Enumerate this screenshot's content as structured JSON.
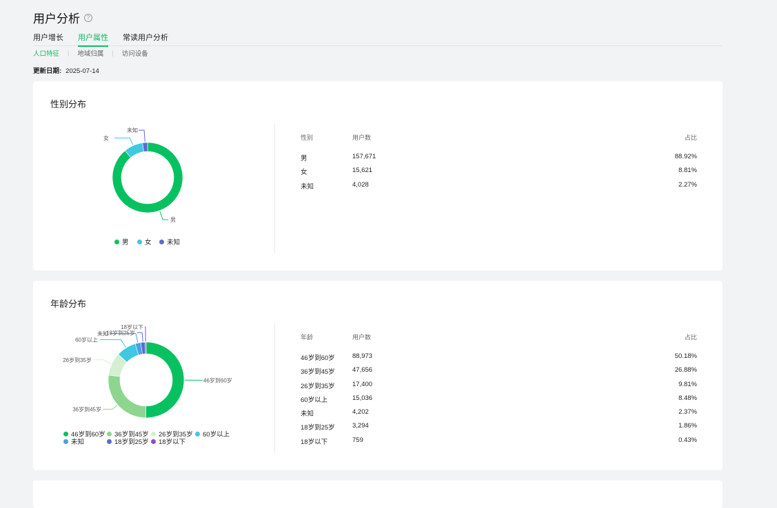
{
  "header": {
    "title": "用户分析",
    "help_icon": "question-circle-icon"
  },
  "tabs": [
    {
      "label": "用户增长",
      "active": false
    },
    {
      "label": "用户属性",
      "active": true
    },
    {
      "label": "常读用户分析",
      "active": false
    }
  ],
  "subtabs": [
    {
      "label": "人口特征",
      "active": true
    },
    {
      "label": "地域归属",
      "active": false
    },
    {
      "label": "访问设备",
      "active": false
    }
  ],
  "update": {
    "label": "更新日期:",
    "date": "2025-07-14"
  },
  "colors": {
    "accent": "#07c160"
  },
  "gender": {
    "title": "性别分布",
    "columns": [
      "性别",
      "用户数",
      "占比"
    ],
    "rows": [
      {
        "name": "男",
        "users": "157,671",
        "pct": "88.92%"
      },
      {
        "name": "女",
        "users": "15,621",
        "pct": "8.81%"
      },
      {
        "name": "未知",
        "users": "4,028",
        "pct": "2.27%"
      }
    ],
    "legend": [
      "男",
      "女",
      "未知"
    ]
  },
  "age": {
    "title": "年龄分布",
    "columns": [
      "年龄",
      "用户数",
      "占比"
    ],
    "rows": [
      {
        "name": "46岁到60岁",
        "users": "88,973",
        "pct": "50.18%"
      },
      {
        "name": "36岁到45岁",
        "users": "47,656",
        "pct": "26.88%"
      },
      {
        "name": "26岁到35岁",
        "users": "17,400",
        "pct": "9.81%"
      },
      {
        "name": "60岁以上",
        "users": "15,036",
        "pct": "8.48%"
      },
      {
        "name": "未知",
        "users": "4,202",
        "pct": "2.37%"
      },
      {
        "name": "18岁到25岁",
        "users": "3,294",
        "pct": "1.86%"
      },
      {
        "name": "18岁以下",
        "users": "759",
        "pct": "0.43%"
      }
    ],
    "legend": [
      "46岁到60岁",
      "36岁到45岁",
      "26岁到35岁",
      "60岁以上",
      "未知",
      "18岁到25岁",
      "18岁以下"
    ]
  },
  "chart_data": [
    {
      "type": "pie",
      "title": "性别分布",
      "categories": [
        "男",
        "女",
        "未知"
      ],
      "values": [
        88.92,
        8.81,
        2.27
      ],
      "colors": [
        "#07c160",
        "#3fc8e0",
        "#5b6bd0"
      ],
      "legend_position": "bottom"
    },
    {
      "type": "pie",
      "title": "年龄分布",
      "categories": [
        "46岁到60岁",
        "36岁到45岁",
        "26岁到35岁",
        "60岁以上",
        "未知",
        "18岁到25岁",
        "18岁以下"
      ],
      "values": [
        50.18,
        26.88,
        9.81,
        8.48,
        2.37,
        1.86,
        0.43
      ],
      "colors": [
        "#07c160",
        "#8ed68f",
        "#d4efd1",
        "#3fc8e0",
        "#4a9ee8",
        "#5b6bd0",
        "#8a4fd0"
      ],
      "legend_position": "bottom"
    }
  ]
}
